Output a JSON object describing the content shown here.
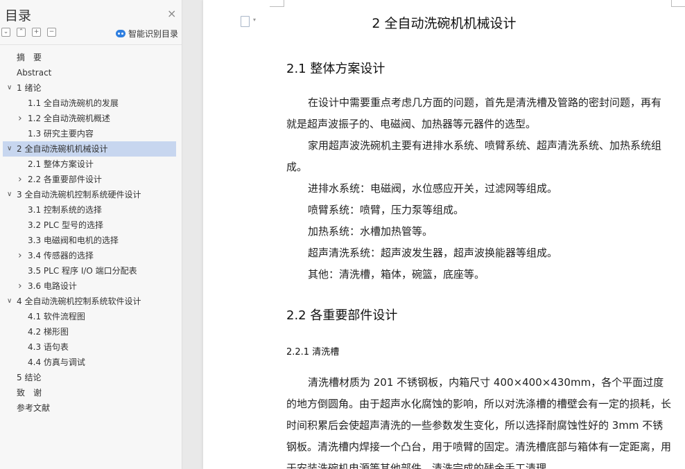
{
  "toc": {
    "title": "目录",
    "close_symbol": "×",
    "tools": [
      "⌄",
      "⌃",
      "+",
      "−"
    ],
    "smart_label": "智能识别目录",
    "items": [
      {
        "label": "摘　要",
        "level": 0,
        "chevron": "",
        "active": false
      },
      {
        "label": "Abstract",
        "level": 0,
        "chevron": "",
        "active": false
      },
      {
        "label": "1 绪论",
        "level": 0,
        "chevron": "down",
        "active": false
      },
      {
        "label": "1.1 全自动洗碗机的发展",
        "level": 1,
        "chevron": "",
        "active": false
      },
      {
        "label": "1.2 全自动洗碗机概述",
        "level": 1,
        "chevron": "right",
        "active": false
      },
      {
        "label": "1.3 研究主要内容",
        "level": 1,
        "chevron": "",
        "active": false
      },
      {
        "label": "2  全自动洗碗机机械设计",
        "level": 0,
        "chevron": "down",
        "active": true
      },
      {
        "label": "2.1  整体方案设计",
        "level": 1,
        "chevron": "",
        "active": false
      },
      {
        "label": "2.2  各重要部件设计",
        "level": 1,
        "chevron": "right",
        "active": false
      },
      {
        "label": "3 全自动洗碗机控制系统硬件设计",
        "level": 0,
        "chevron": "down",
        "active": false
      },
      {
        "label": "3.1 控制系统的选择",
        "level": 1,
        "chevron": "",
        "active": false
      },
      {
        "label": "3.2 PLC 型号的选择",
        "level": 1,
        "chevron": "",
        "active": false
      },
      {
        "label": "3.3 电磁阀和电机的选择",
        "level": 1,
        "chevron": "",
        "active": false
      },
      {
        "label": "3.4  传感器的选择",
        "level": 1,
        "chevron": "right",
        "active": false
      },
      {
        "label": "3.5 PLC 程序 I/O 端口分配表",
        "level": 1,
        "chevron": "",
        "active": false
      },
      {
        "label": "3.6 电路设计",
        "level": 1,
        "chevron": "right",
        "active": false
      },
      {
        "label": "4 全自动洗碗机控制系统软件设计",
        "level": 0,
        "chevron": "down",
        "active": false
      },
      {
        "label": "4.1 软件流程图",
        "level": 1,
        "chevron": "",
        "active": false
      },
      {
        "label": "4.2 梯形图",
        "level": 1,
        "chevron": "",
        "active": false
      },
      {
        "label": "4.3 语句表",
        "level": 1,
        "chevron": "",
        "active": false
      },
      {
        "label": "4.4 仿真与调试",
        "level": 1,
        "chevron": "",
        "active": false
      },
      {
        "label": "5 结论",
        "level": 0,
        "chevron": "",
        "active": false
      },
      {
        "label": "致　谢",
        "level": 0,
        "chevron": "",
        "active": false
      },
      {
        "label": "参考文献",
        "level": 0,
        "chevron": "",
        "active": false
      }
    ]
  },
  "doc": {
    "chapter_title": "2  全自动洗碗机机械设计",
    "icon_caret": "▾",
    "h2_1": "2.1  整体方案设计",
    "p1": "在设计中需要重点考虑几方面的问题，首先是清洗槽及管路的密封问题，再有就是超声波振子的、电磁阀、加热器等元器件的选型。",
    "p2": "家用超声波洗碗机主要有进排水系统、喷臂系统、超声清洗系统、加热系统组成。",
    "p3": "进排水系统：电磁阀，水位感应开关，过滤网等组成。",
    "p4": "喷臂系统：喷臂，压力泵等组成。",
    "p5": "加热系统：水槽加热管等。",
    "p6": "超声清洗系统：超声波发生器，超声波换能器等组成。",
    "p7": "其他：清洗槽，箱体，碗篮，底座等。",
    "h2_2": "2.2  各重要部件设计",
    "h3_1": "2.2.1 清洗槽",
    "p8": "清洗槽材质为 201 不锈钢板，内箱尺寸 400×400×430mm，各个平面过度的地方倒圆角。由于超声水化腐蚀的影响，所以对洗涤槽的槽壁会有一定的损耗，长时间积累后会使超声清洗的一些参数发生变化，所以选择耐腐蚀性好的 3mm 不锈钢板。清洗槽内焊接一个凸台，用于喷臂的固定。清洗槽底部与箱体有一定距离，用于安装洗碗机电源等其他部件，清洗完成的残余手工清理。"
  }
}
